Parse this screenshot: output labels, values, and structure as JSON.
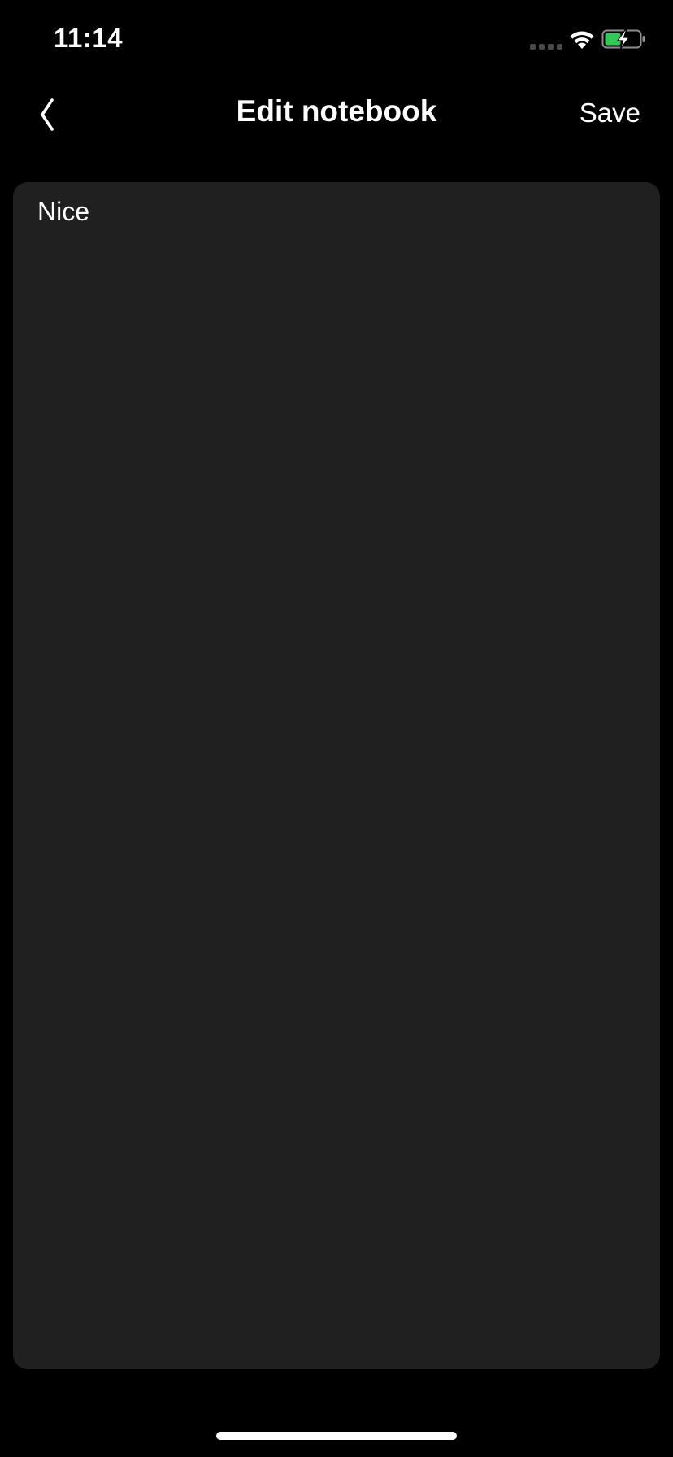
{
  "status_bar": {
    "time": "11:14",
    "battery_color": "#34c759"
  },
  "nav": {
    "title": "Edit notebook",
    "save_label": "Save",
    "back_icon": "chevron-left-icon"
  },
  "editor": {
    "value": "Nice",
    "background": "#202020"
  }
}
